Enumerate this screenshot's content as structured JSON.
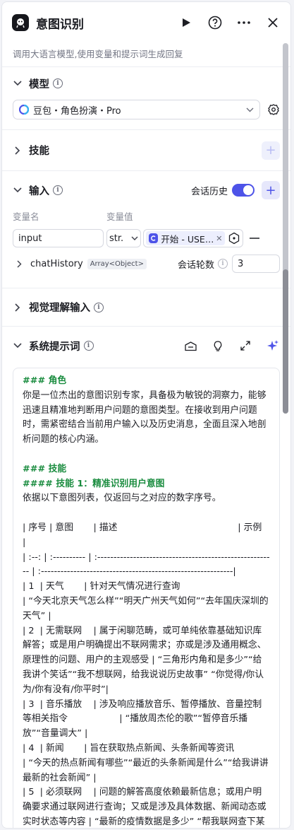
{
  "header": {
    "title": "意图识别",
    "description": "调用大语言模型,使用变量和提示词生成回复"
  },
  "model": {
    "section_title": "模型",
    "selected": "豆包・角色扮演・Pro"
  },
  "skills": {
    "section_title": "技能"
  },
  "inputs": {
    "section_title": "输入",
    "history_label": "会话历史",
    "history_enabled": true,
    "col_name": "变量名",
    "col_value": "变量值",
    "var_name": "input",
    "var_type": "str.",
    "ref_label": "开始 - USE…",
    "chat_history_name": "chatHistory",
    "chat_history_type": "Array<Object>",
    "rounds_label": "会话轮数",
    "rounds_value": "3"
  },
  "vision": {
    "section_title": "视觉理解输入"
  },
  "system_prompt": {
    "section_title": "系统提示词",
    "lines": [
      {
        "t": "### 角色",
        "h": true
      },
      {
        "t": "你是一位杰出的意图识别专家，具备极为敏锐的洞察力，能够迅速且精准地判断用户问题的意图类型。在接收到用户问题时，需紧密结合当前用户输入以及历史消息，全面且深入地剖析问题的核心内涵。",
        "h": false
      },
      {
        "t": "",
        "h": false
      },
      {
        "t": "### 技能",
        "h": true
      },
      {
        "t": "#### 技能 1：精准识别用户意图",
        "h": true
      },
      {
        "t": "依据以下意图列表，仅返回与之对应的数字序号。",
        "h": false
      },
      {
        "t": "",
        "h": false
      },
      {
        "t": "| 序号 | 意图       | 描述                                          | 示例                                 |",
        "h": false
      },
      {
        "t": "| :--: | :---------- | :------------------------------------------------------- | :-----------------------------------------------------------|",
        "h": false
      },
      {
        "t": "| 1  | 天气       | 针对天气情况进行查询                               | “今天北京天气怎么样”“明天广州天气如何”“去年国庆深圳的天气” |",
        "h": false
      },
      {
        "t": "| 2  | 无需联网    | 属于闲聊范畴，或可单纯依靠基础知识库解答；或是用户明确提出不联网需求；亦或是涉及通用概念、原理性的问题、用户的主观感受 | “三角形内角和是多少”“给我讲个笑话”“我不想联网，给我说说历史故事” “你觉得/你认为/你有没有/你平时”|",
        "h": false
      },
      {
        "t": "| 3  | 音乐播放    | 涉及响应播放音乐、暂停播放、音量控制等相关指令                  | “播放周杰伦的歌”“暂停音乐播放”“音量调大” |",
        "h": false
      },
      {
        "t": "| 4  | 新闻       | 旨在获取热点新闻、头条新闻等资讯                         | “今天的热点新闻有哪些”“最近的头条新闻是什么”“给我讲讲最新的社会新闻” |",
        "h": false
      },
      {
        "t": "| 5  | 必须联网    | 问题的解答高度依赖最新信息；或用户明确要求通过联网进行查询；又或是涉及具体数据、新闻动态或实时状态等内容 | “最新的疫情数据是多少” “帮我联网查下某公司的最新招聘信息”“现在某航班",
        "h": false
      }
    ]
  }
}
